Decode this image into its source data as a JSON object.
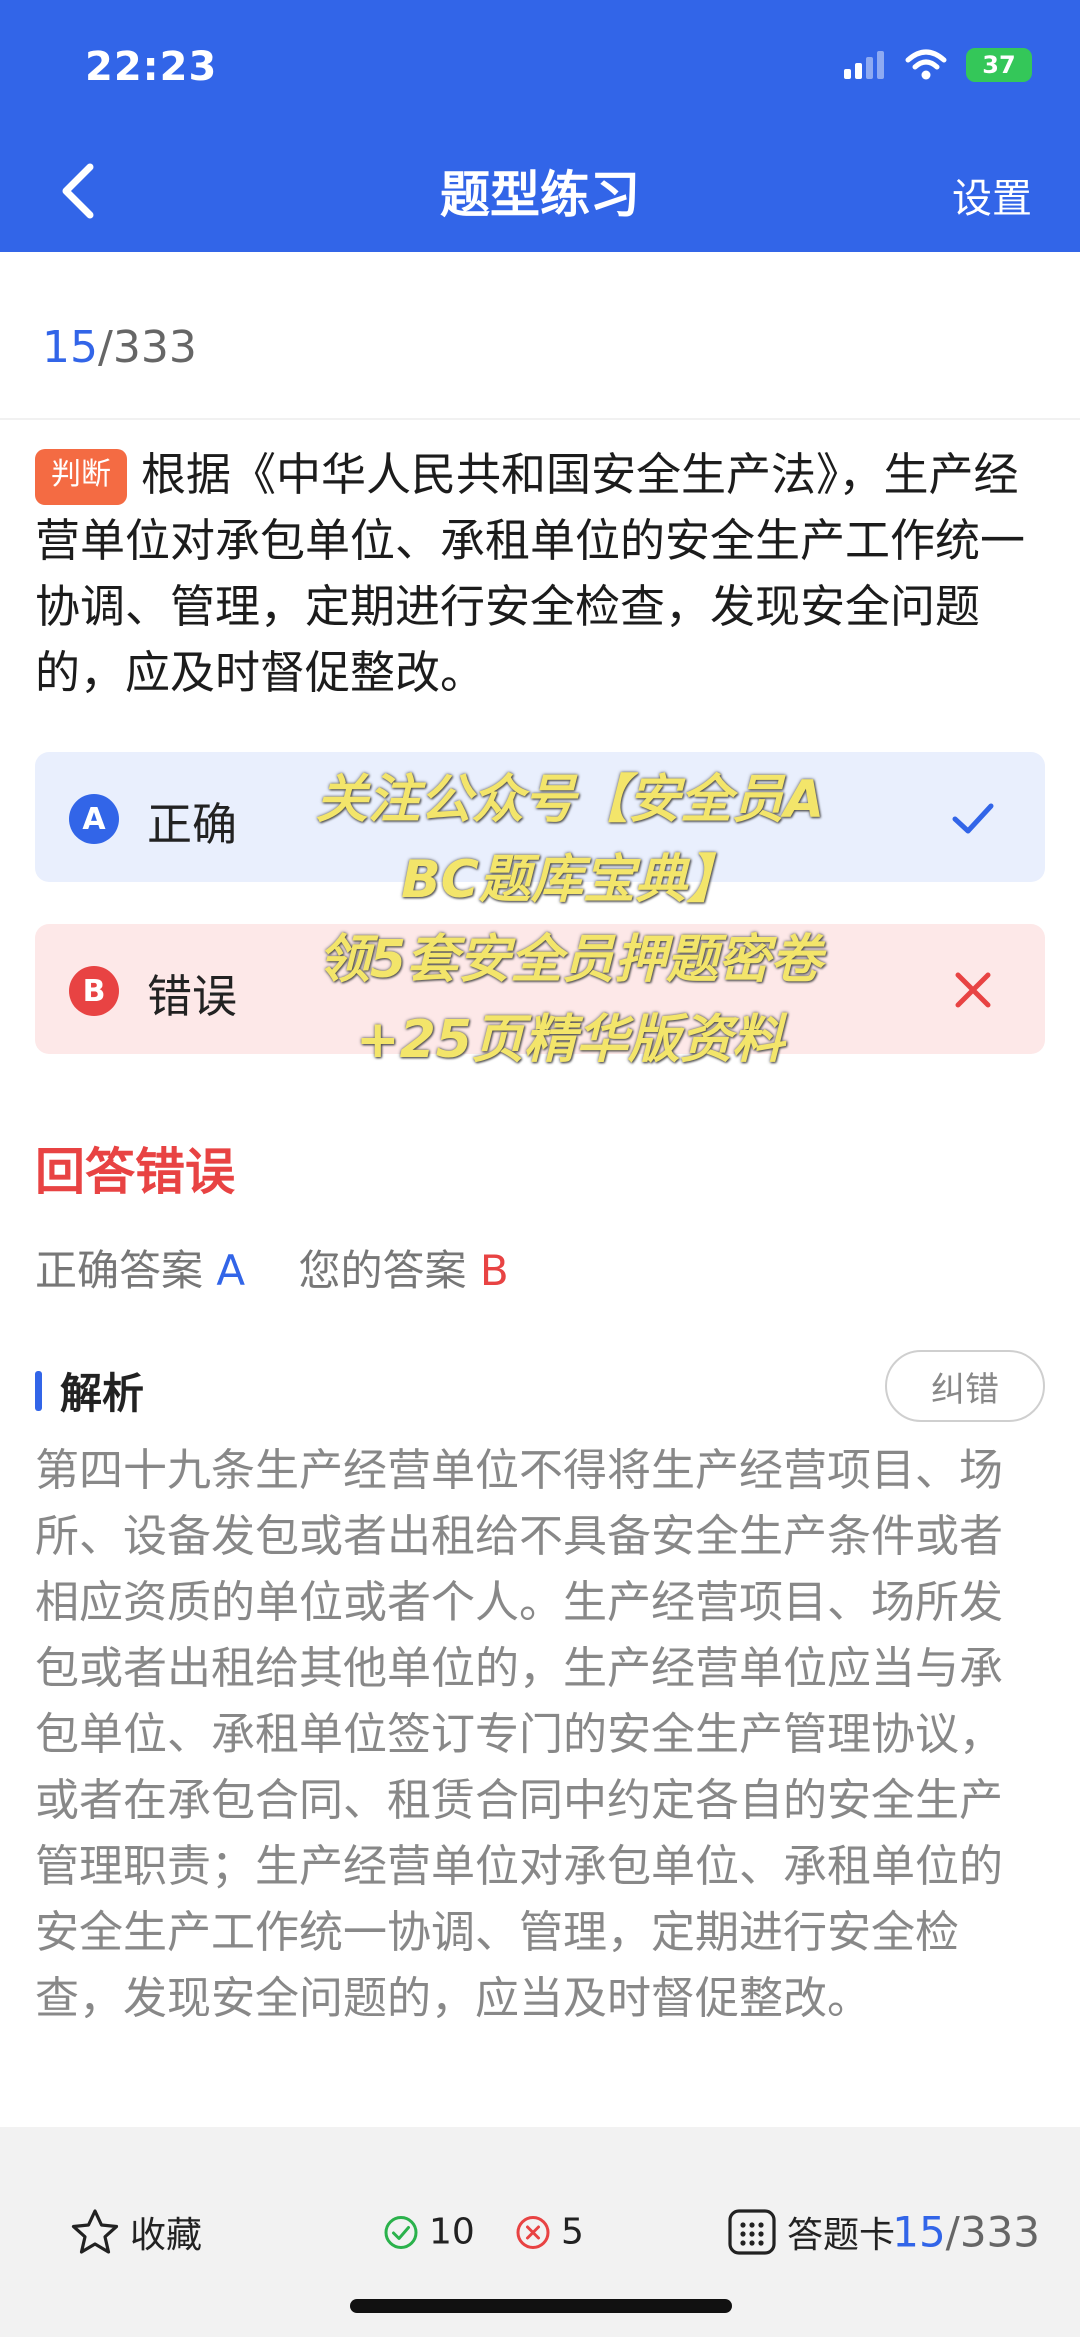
{
  "status_bar": {
    "time": "22:23",
    "battery": "37"
  },
  "nav": {
    "title": "题型练习",
    "settings": "设置"
  },
  "progress": {
    "current": "15",
    "total": "/333"
  },
  "question": {
    "tag": "判断",
    "text": "根据《中华人民共和国安全生产法》，生产经营单位对承包单位、承租单位的安全生产工作统一协调、管理，定期进行安全检查，发现安全问题的，应及时督促整改。"
  },
  "options": [
    {
      "letter": "A",
      "text": "正确",
      "mark": "check-icon",
      "state": "correct"
    },
    {
      "letter": "B",
      "text": "错误",
      "mark": "cross-icon",
      "state": "wrong"
    }
  ],
  "watermark": {
    "line1": "关注公众号【安全员A",
    "line2": "BC题库宝典】",
    "line3": "领5套安全员押题密卷",
    "line4": "+25页精华版资料"
  },
  "result": {
    "title": "回答错误",
    "correct_label": "正确答案",
    "correct_value": "A",
    "mine_label": "您的答案",
    "mine_value": "B"
  },
  "analysis": {
    "title": "解析",
    "report_button": "纠错",
    "text": "第四十九条生产经营单位不得将生产经营项目、场所、设备发包或者出租给不具备安全生产条件或者相应资质的单位或者个人。生产经营项目、场所发包或者出租给其他单位的，生产经营单位应当与承包单位、承租单位签订专门的安全生产管理协议，或者在承包合同、租赁合同中约定各自的安全生产管理职责；生产经营单位对承包单位、承租单位的安全生产工作统一协调、管理，定期进行安全检查，发现安全问题的，应当及时督促整改。"
  },
  "bottom_bar": {
    "favorite": "收藏",
    "right_count": "10",
    "wrong_count": "5",
    "answer_card": "答题卡",
    "progress_current": "15",
    "progress_total": "/333"
  },
  "colors": {
    "primary": "#3265e8",
    "error": "#e84343",
    "tag": "#f46b43",
    "success": "#34c759"
  }
}
